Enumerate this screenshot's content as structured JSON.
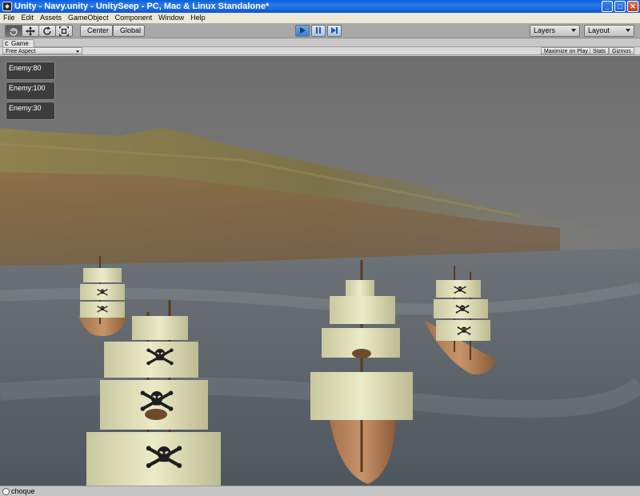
{
  "window": {
    "title": "Unity - Navy.unity - UnitySeep - PC, Mac & Linux Standalone*",
    "minimize_glyph": "_",
    "maximize_glyph": "□",
    "close_glyph": "✕"
  },
  "menu": [
    "File",
    "Edit",
    "Assets",
    "GameObject",
    "Component",
    "Window",
    "Help"
  ],
  "toolbar": {
    "tools": [
      "hand-icon",
      "move-icon",
      "rotate-icon",
      "scale-icon"
    ],
    "pivot_label": "Center",
    "space_label": "Global",
    "layers_label": "Layers",
    "layout_label": "Layout",
    "accent": "#3d7fcf"
  },
  "game": {
    "tab_label": "Game",
    "aspect_label": "Free Aspect",
    "maximize_label": "Maximize on Play",
    "stats_label": "Stats",
    "gizmos_label": "Gizmos"
  },
  "hud": {
    "enemies": [
      "Enemy:80",
      "Enemy:100",
      "Enemy:30"
    ]
  },
  "status": {
    "message": "choque"
  }
}
